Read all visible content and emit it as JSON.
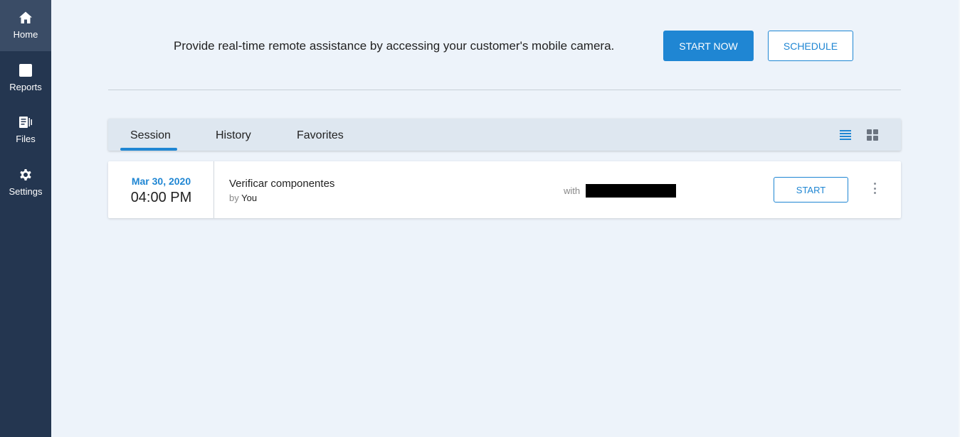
{
  "sidebar": {
    "items": [
      {
        "label": "Home",
        "icon": "home-icon"
      },
      {
        "label": "Reports",
        "icon": "reports-icon"
      },
      {
        "label": "Files",
        "icon": "files-icon"
      },
      {
        "label": "Settings",
        "icon": "gear-icon"
      }
    ]
  },
  "promo": {
    "text": "Provide real-time remote assistance by accessing your customer's mobile camera.",
    "start_now_label": "START NOW",
    "schedule_label": "SCHEDULE"
  },
  "tabs": [
    {
      "label": "Session",
      "active": true
    },
    {
      "label": "History",
      "active": false
    },
    {
      "label": "Favorites",
      "active": false
    }
  ],
  "view_toggle": {
    "list_icon": "list-view-icon",
    "grid_icon": "grid-view-icon",
    "active": "list"
  },
  "session": {
    "date": "Mar 30, 2020",
    "time": "04:00 PM",
    "title": "Verificar componentes",
    "by_prefix": "by",
    "by_user": "You",
    "with_label": "with",
    "start_label": "START"
  },
  "colors": {
    "accent": "#1f86d3",
    "sidebar_bg": "#243650",
    "page_bg": "#edf3fa"
  }
}
